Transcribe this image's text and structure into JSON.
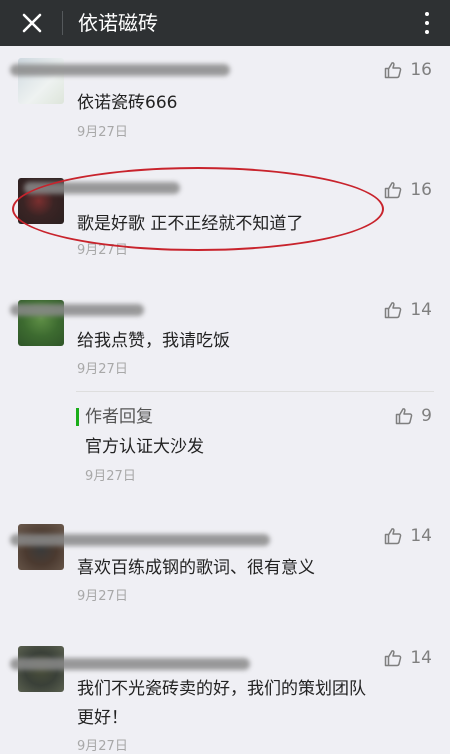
{
  "header": {
    "title": "依诺磁砖",
    "close_icon": "close-icon",
    "more_icon": "more-vertical-icon"
  },
  "comments": [
    {
      "content": "依诺瓷砖666",
      "date": "9月27日",
      "likes": "16"
    },
    {
      "content": "歌是好歌 正不正经就不知道了",
      "date": "9月27日",
      "likes": "16"
    },
    {
      "content": "给我点赞，我请吃饭",
      "date": "9月27日",
      "likes": "14",
      "reply": {
        "tag": "作者回复",
        "content": "官方认证大沙发",
        "date": "9月27日",
        "likes": "9"
      }
    },
    {
      "content": "喜欢百练成钢的歌词、很有意义",
      "date": "9月27日",
      "likes": "14"
    },
    {
      "content_line1": "我们不光瓷砖卖的好，我们的策划团队",
      "content_line2": "更好！",
      "date": "9月27日",
      "likes": "14"
    }
  ],
  "colors": {
    "header_bg": "#2e3133",
    "page_bg": "#efeff4",
    "reply_accent": "#1aad19",
    "annotation": "#c8232c"
  }
}
